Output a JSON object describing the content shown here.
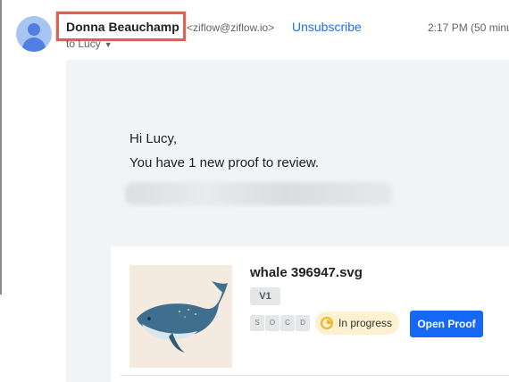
{
  "sender": {
    "name": "Donna Beauchamp",
    "email": "<ziflow@ziflow.io>",
    "unsubscribe_label": "Unsubscribe",
    "timestamp": "2:17 PM (50 minu",
    "to_label": "to Lucy"
  },
  "message": {
    "greeting": "Hi Lucy,",
    "intro": "You have 1 new proof to review."
  },
  "proof": {
    "filename": "whale 396947.svg",
    "version": "V1",
    "stage_chips": [
      "S",
      "O",
      "C",
      "D"
    ],
    "status": "In progress",
    "open_button": "Open Proof"
  },
  "colors": {
    "highlight_border": "#e06055",
    "link_blue": "#1a73e8",
    "button_blue": "#1468f5",
    "status_bg": "#fdf1cf",
    "status_icon": "#f0b429"
  }
}
